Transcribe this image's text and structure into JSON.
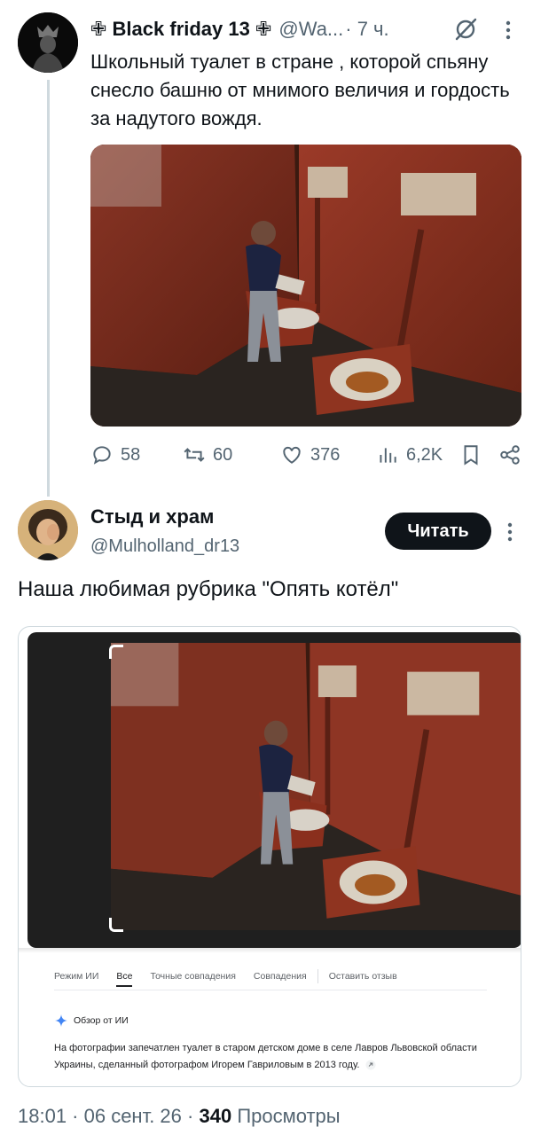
{
  "tweet1": {
    "name": "✙ Black friday 13 ✙",
    "handle": "@Wa...",
    "time": "· 7 ч.",
    "text": "Школьный туалет в стране , которой спьяну снесло башню от мнимого величия и гордость за надутого вождя.",
    "stats": {
      "replies": "58",
      "reposts": "60",
      "likes": "376",
      "views": "6,2K"
    }
  },
  "tweet2": {
    "name": "Стыд и храм",
    "handle": "@Mulholland_dr13",
    "follow_label": "Читать",
    "text": "Наша любимая рубрика \"Опять котёл\""
  },
  "embedded": {
    "tabs": [
      "Режим ИИ",
      "Все",
      "Точные совпадения",
      "Совпадения",
      "Оставить отзыв"
    ],
    "active_tab": "Все",
    "ai_overview_title": "Обзор от ИИ",
    "ai_overview_text": "На фотографии запечатлен туалет в старом детском доме в селе Лавров Львовской области Украины, сделанный фотографом Игорем Гавриловым в 2013 году."
  },
  "footer": {
    "time": "18:01 · 06 сент. 26 ·",
    "views_count": "340",
    "views_label": "Просмотры"
  },
  "colors": {
    "text_primary": "#0f1419",
    "text_secondary": "#536471",
    "wall_red": "#7a2a1a",
    "follow_bg": "#0f1419"
  }
}
